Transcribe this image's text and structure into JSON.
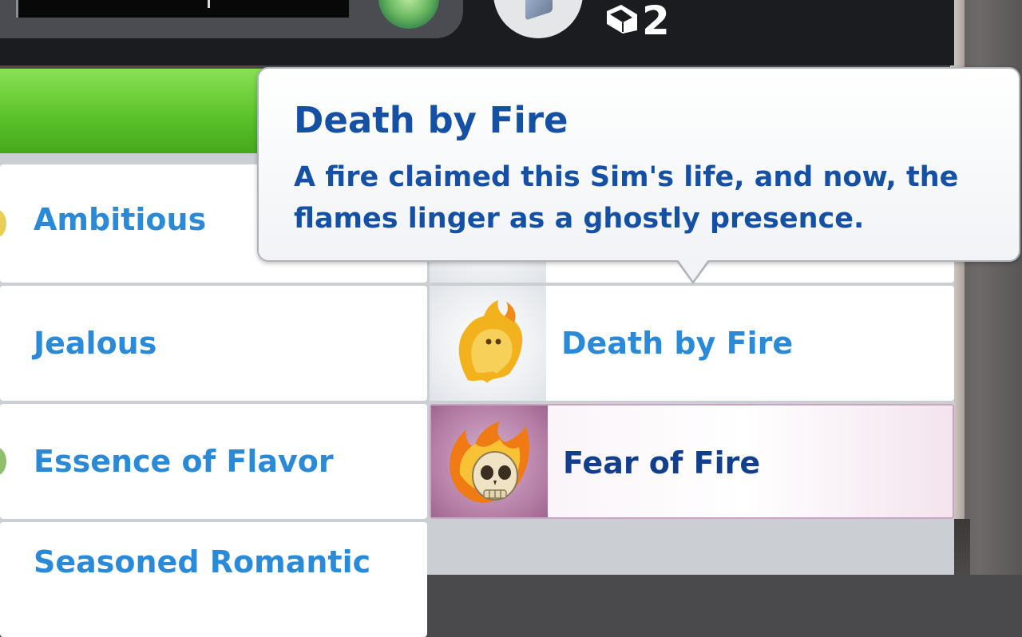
{
  "hud": {
    "book_count": "2"
  },
  "tooltip": {
    "title": "Death by Fire",
    "description": "A fire claimed this Sim's life, and now, the flames linger as a ghostly presence."
  },
  "traits": {
    "left": [
      {
        "label": "Ambitious"
      },
      {
        "label": "Jealous"
      },
      {
        "label": "Essence of Flavor"
      },
      {
        "label": "Seasoned Romantic"
      }
    ],
    "right": [
      {
        "label": "Death by Fire",
        "icon": "flame-ghost-icon"
      },
      {
        "label": "Fear of Fire",
        "icon": "flaming-skull-icon",
        "selected": true
      }
    ]
  },
  "colors": {
    "accent_green": "#5cc42a",
    "label_blue": "#2b8ad8",
    "tooltip_blue": "#1450a4",
    "selected_label": "#123f8c"
  }
}
